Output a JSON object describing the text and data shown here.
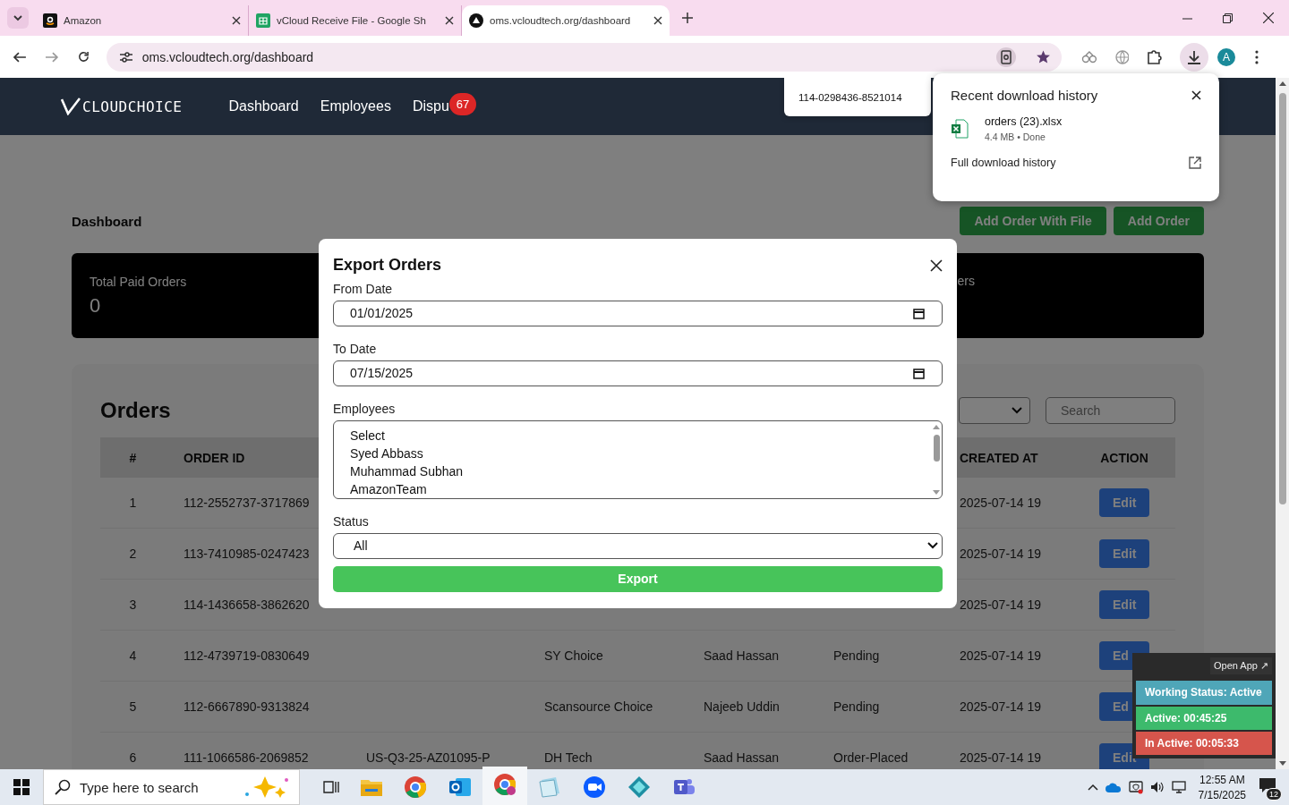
{
  "browser": {
    "tabs": [
      {
        "title": "Amazon",
        "kind": "store",
        "selected": false
      },
      {
        "title": "vCloud Receive File - Google Sh",
        "kind": "sheet",
        "selected": false
      },
      {
        "title": "oms.vcloudtech.org/dashboard",
        "kind": "site",
        "selected": true
      }
    ],
    "address": "oms.vcloudtech.org/dashboard",
    "profile_initial": "A"
  },
  "navbar": {
    "brand": "CLOUDCHOICE",
    "links": [
      {
        "label": "Dashboard"
      },
      {
        "label": "Employees"
      },
      {
        "label": "Dispu",
        "badge": "67"
      }
    ]
  },
  "tooltip": "114-0298436-8521014",
  "downloads": {
    "title": "Recent download history",
    "files": [
      {
        "name": "orders (23).xlsx",
        "meta": "4.4 MB • Done"
      }
    ],
    "footer": "Full download history"
  },
  "page": {
    "title": "Dashboard",
    "buttons": [
      "Add Order With File",
      "Add Order"
    ]
  },
  "stats": [
    {
      "label": "Total Paid Orders",
      "value": "0"
    }
  ],
  "stat_fragment": "ers",
  "orders": {
    "title": "Orders",
    "search_placeholder": "Search",
    "columns": {
      "number": "#",
      "order_id": "ORDER ID",
      "created_at": "CREATED AT",
      "action": "ACTION"
    },
    "rows": [
      {
        "number": "1",
        "order_id": "112-2552737-3717869",
        "created_at": "2025-07-14 19",
        "action": "Edit"
      },
      {
        "number": "2",
        "order_id": "113-7410985-0247423",
        "created_at": "2025-07-14 19",
        "action": "Edit"
      },
      {
        "number": "3",
        "order_id": "114-1436658-3862620",
        "created_at": "2025-07-14 19",
        "action": "Edit"
      },
      {
        "number": "4",
        "order_id": "112-4739719-0830649",
        "column_4": "SY Choice",
        "column_5": "Saad Hassan",
        "column_6": "Pending",
        "created_at": "2025-07-14 19",
        "action": "Ed"
      },
      {
        "number": "5",
        "order_id": "112-6667890-9313824",
        "column_4": "Scansource Choice",
        "column_5": "Najeeb Uddin",
        "column_6": "Pending",
        "created_at": "2025-07-14 19",
        "action": "Ed"
      },
      {
        "number": "6",
        "order_id": "111-1066586-2069852",
        "column_3": "US-Q3-25-AZ01095-P",
        "column_4": "DH Tech",
        "column_5": "Saad Hassan",
        "column_6": "Order-Placed",
        "created_at": "2025-07-14 19",
        "action": "Edit"
      }
    ]
  },
  "modal": {
    "title": "Export Orders",
    "from_label": "From Date",
    "from_value": "01/01/2025",
    "to_label": "To Date",
    "to_value": "07/15/2025",
    "employees_label": "Employees",
    "employees": [
      {
        "name": "Select",
        "selected": false
      },
      {
        "name": "Syed Abbass",
        "selected": false
      },
      {
        "name": "Muhammad Subhan",
        "selected": false
      },
      {
        "name": "AmazonTeam",
        "selected": false
      }
    ],
    "status_label": "Status",
    "status_value": "All",
    "export_button": "Export"
  },
  "tracker": {
    "open_app": "Open App ↗",
    "statuses": [
      {
        "text": "Working Status: Active",
        "color": "#4fa6b8"
      },
      {
        "text": "Active: 00:45:25",
        "color": "#3dba6c"
      },
      {
        "text": "In Active: 00:05:33",
        "color": "#d6554c"
      }
    ]
  },
  "taskbar": {
    "search_placeholder": "Type here to search",
    "time": "12:55 AM",
    "date": "7/15/2025",
    "notifications": "12"
  }
}
